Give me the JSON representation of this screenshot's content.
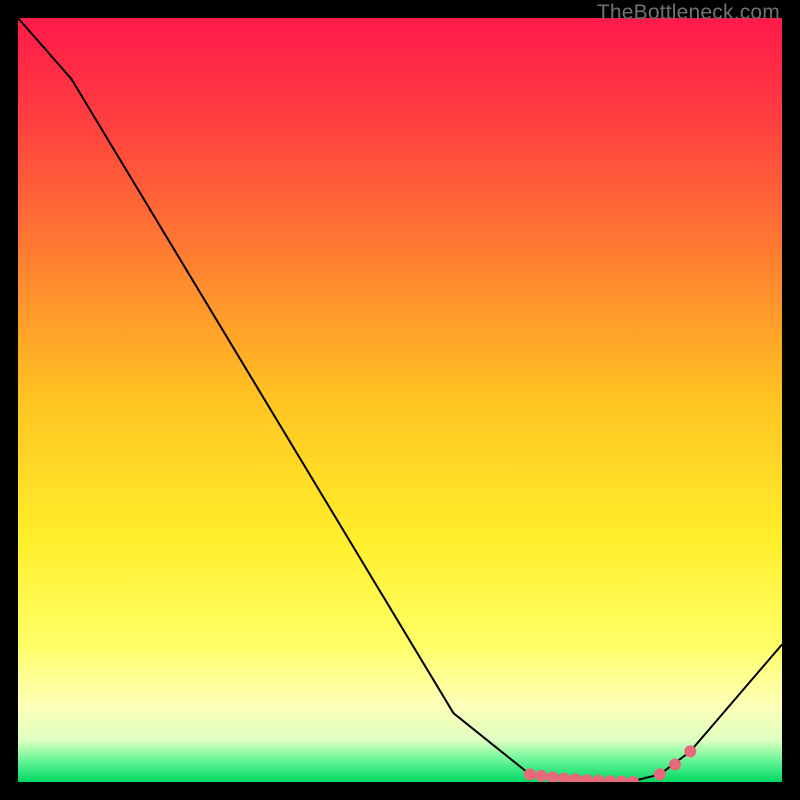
{
  "watermark": "TheBottleneck.com",
  "chart_data": {
    "type": "line",
    "title": "",
    "xlabel": "",
    "ylabel": "",
    "xlim": [
      0,
      100
    ],
    "ylim": [
      0,
      100
    ],
    "x": [
      0,
      7,
      57,
      67,
      80,
      84,
      88,
      100
    ],
    "y": [
      100,
      92,
      9,
      1,
      0,
      1,
      4,
      18
    ],
    "highlight_region": {
      "x_start": 67,
      "x_end": 88
    },
    "highlight_points_x": [
      67,
      68.5,
      70,
      71.5,
      73,
      74.5,
      76,
      77.5,
      79,
      80.5,
      84,
      86,
      88
    ],
    "highlight_points_y": [
      1,
      0.8,
      0.6,
      0.45,
      0.35,
      0.25,
      0.18,
      0.1,
      0.05,
      0,
      1,
      2.3,
      4
    ],
    "background_gradient": {
      "stops": [
        {
          "offset": 0.0,
          "color": "#ff1a4a"
        },
        {
          "offset": 0.12,
          "color": "#ff3a41"
        },
        {
          "offset": 0.3,
          "color": "#ff7a32"
        },
        {
          "offset": 0.5,
          "color": "#ffc421"
        },
        {
          "offset": 0.68,
          "color": "#ffee2a"
        },
        {
          "offset": 0.82,
          "color": "#ffff66"
        },
        {
          "offset": 0.9,
          "color": "#fdffb8"
        },
        {
          "offset": 0.945,
          "color": "#dfffc0"
        },
        {
          "offset": 0.97,
          "color": "#6ef79a"
        },
        {
          "offset": 1.0,
          "color": "#00d863"
        }
      ]
    },
    "curve_color": "#000000",
    "marker_color": "#e86a7a"
  }
}
